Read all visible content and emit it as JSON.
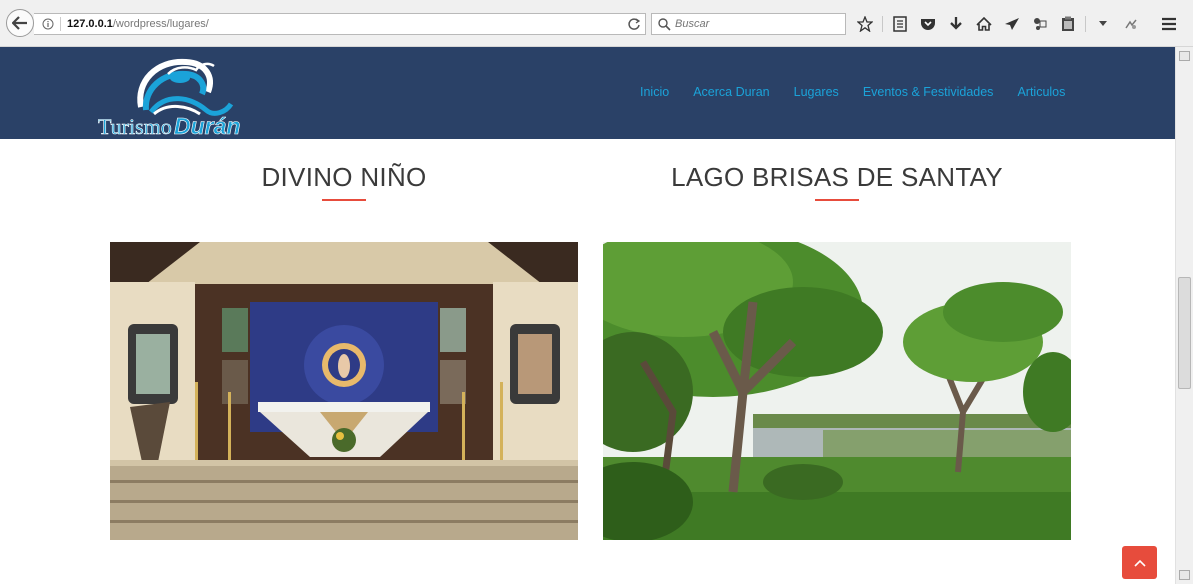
{
  "browser": {
    "url_host": "127.0.0.1",
    "url_path": "/wordpress/lugares/",
    "search_placeholder": "Buscar"
  },
  "site": {
    "logo_text_1": "Turismo",
    "logo_text_2": "Durán",
    "nav": [
      {
        "label": "Inicio"
      },
      {
        "label": "Acerca Duran"
      },
      {
        "label": "Lugares"
      },
      {
        "label": "Eventos & Festividades"
      },
      {
        "label": "Articulos"
      }
    ],
    "nav_color": "#1ba3d9",
    "header_color": "#2a4167"
  },
  "places": [
    {
      "title": "DIVINO NIÑO"
    },
    {
      "title": "LAGO BRISAS DE SANTAY"
    }
  ],
  "accent": "#e74c3c"
}
